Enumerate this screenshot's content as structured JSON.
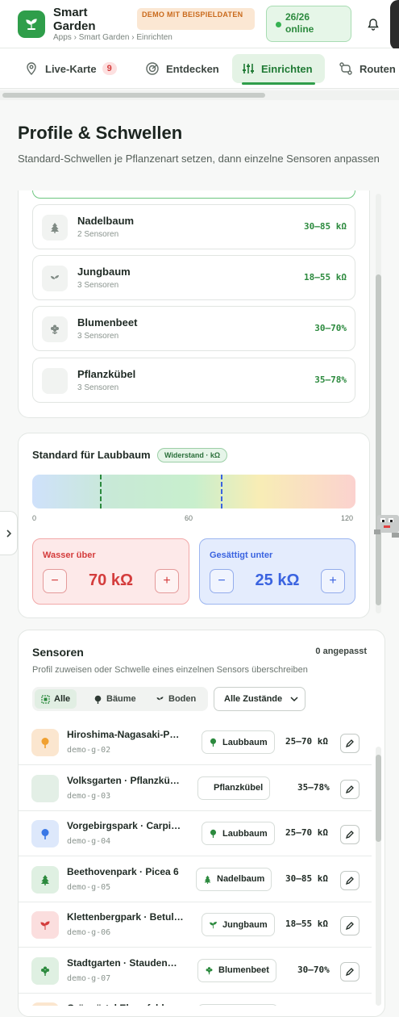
{
  "app": {
    "title": "Smart Garden",
    "breadcrumb": [
      "Apps",
      "Smart Garden",
      "Einrichten"
    ],
    "demo_badge": "DEMO MIT BEISPIELDATEN",
    "online_status": "26/26 online"
  },
  "tabs": [
    {
      "label": "Live-Karte",
      "icon": "map-pin-icon",
      "badge": "9"
    },
    {
      "label": "Entdecken",
      "icon": "radar-icon"
    },
    {
      "label": "Einrichten",
      "icon": "sliders-icon",
      "active": true
    },
    {
      "label": "Routen",
      "icon": "route-icon"
    }
  ],
  "page": {
    "title": "Profile & Schwellen",
    "subtitle": "Standard-Schwellen je Pflanzenart setzen, dann einzelne Sensoren anpassen"
  },
  "profiles": [
    {
      "name": "Nadelbaum",
      "count": "2 Sensoren",
      "range": "30–85 kΩ",
      "icon": "conifer-icon"
    },
    {
      "name": "Jungbaum",
      "count": "3 Sensoren",
      "range": "18–55 kΩ",
      "icon": "sprout-icon"
    },
    {
      "name": "Blumenbeet",
      "count": "3 Sensoren",
      "range": "30–70%",
      "icon": "flower-icon"
    },
    {
      "name": "Pflanzkübel",
      "count": "3 Sensoren",
      "range": "35–78%",
      "icon": ""
    }
  ],
  "standard": {
    "title": "Standard für Laubbaum",
    "mode": "Widerstand · kΩ",
    "scale_ticks": [
      "0",
      "60",
      "120"
    ],
    "scale_min": 0,
    "scale_max": 120,
    "water_threshold": 70,
    "saturated_threshold": 25,
    "water_label": "Wasser über",
    "water_value": "70 kΩ",
    "saturated_label": "Gesättigt unter",
    "saturated_value": "25 kΩ",
    "minus": "−",
    "plus": "+"
  },
  "sensors": {
    "title": "Sensoren",
    "adjusted": "0 angepasst",
    "description": "Profil zuweisen oder Schwelle eines einzelnen Sensors überschreiben",
    "filters": [
      {
        "label": "Alle",
        "active": true
      },
      {
        "label": "Bäume"
      },
      {
        "label": "Boden"
      }
    ],
    "state_select": "Alle Zustände",
    "rows": [
      {
        "name": "Hiroshima-Nagasaki-P…",
        "id": "demo-g-02",
        "profile": "Laubbaum",
        "range": "25–70 kΩ",
        "color": "#fbe6cf",
        "icon_color": "#f0a030",
        "icon": "deciduous-tree-icon"
      },
      {
        "name": "Volksgarten · Pflanzkü…",
        "id": "demo-g-03",
        "profile": "Pflanzkübel",
        "range": "35–78%",
        "color": "#e3efe6",
        "icon_color": "",
        "icon": ""
      },
      {
        "name": "Vorgebirgspark · Carpi…",
        "id": "demo-g-04",
        "profile": "Laubbaum",
        "range": "25–70 kΩ",
        "color": "#dde8fb",
        "icon_color": "#3a78e6",
        "icon": "deciduous-tree-icon"
      },
      {
        "name": "Beethovenpark · Picea 6",
        "id": "demo-g-05",
        "profile": "Nadelbaum",
        "range": "30–85 kΩ",
        "color": "#dff0e2",
        "icon_color": "#2c8a3e",
        "icon": "conifer-icon"
      },
      {
        "name": "Klettenbergpark · Betul…",
        "id": "demo-g-06",
        "profile": "Jungbaum",
        "range": "18–55 kΩ",
        "color": "#fbdede",
        "icon_color": "#d43c3c",
        "icon": "sprout-icon"
      },
      {
        "name": "Stadtgarten · Stauden…",
        "id": "demo-g-07",
        "profile": "Blumenbeet",
        "range": "30–70%",
        "color": "#dff0e2",
        "icon_color": "#2c8a3e",
        "icon": "flower-icon"
      },
      {
        "name": "Grüngürtel Ehrenfeld ·",
        "id": "",
        "profile": "",
        "range": "",
        "color": "#fbe6cf",
        "icon_color": "#f0a030",
        "icon": "deciduous-tree-icon"
      }
    ]
  }
}
